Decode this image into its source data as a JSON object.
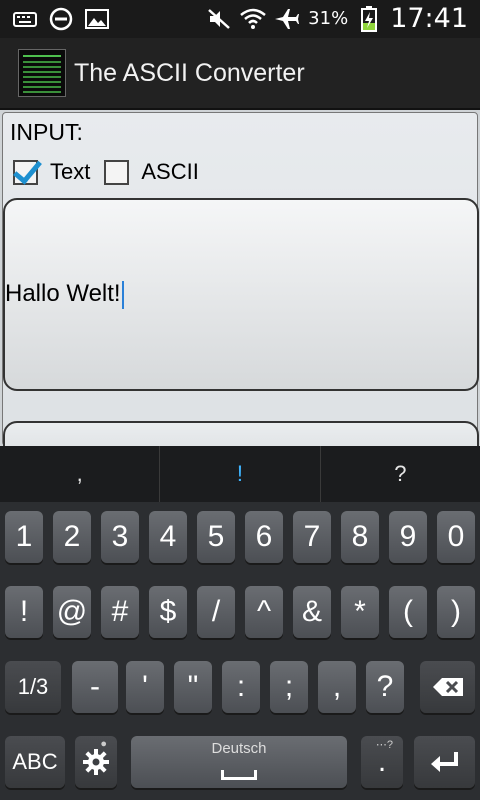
{
  "status_bar": {
    "battery_percent": "31%",
    "time": "17:41",
    "icons": [
      "keyboard-icon",
      "do-not-disturb-icon",
      "image-icon",
      "mute-icon",
      "wifi-icon",
      "airplane-icon",
      "battery-charging-icon"
    ]
  },
  "action_bar": {
    "title": "The ASCII Converter",
    "app_icon": "ascii-converter-app-icon"
  },
  "form": {
    "input_label": "INPUT:",
    "checkbox_text_label": "Text",
    "checkbox_text_checked": true,
    "checkbox_ascii_label": "ASCII",
    "checkbox_ascii_checked": false,
    "input_value": "Hallo Welt!"
  },
  "keyboard": {
    "suggestions": [
      ",",
      "!",
      "?"
    ],
    "row1": [
      "1",
      "2",
      "3",
      "4",
      "5",
      "6",
      "7",
      "8",
      "9",
      "0"
    ],
    "row2": [
      "!",
      "@",
      "#",
      "$",
      "/",
      "^",
      "&",
      "*",
      "(",
      ")"
    ],
    "row3": {
      "shift_label": "1/3",
      "keys": [
        "-",
        "'",
        "\"",
        ":",
        ";",
        ",",
        "?"
      ],
      "backspace_icon": "backspace-icon"
    },
    "row4": {
      "abc_label": "ABC",
      "settings_icon": "gear-icon",
      "space_label": "Deutsch",
      "period": ".",
      "enter_icon": "enter-icon"
    },
    "colors": {
      "accent": "#3fb4ff",
      "key": "#5a5d62",
      "background": "#2c2e31"
    }
  }
}
